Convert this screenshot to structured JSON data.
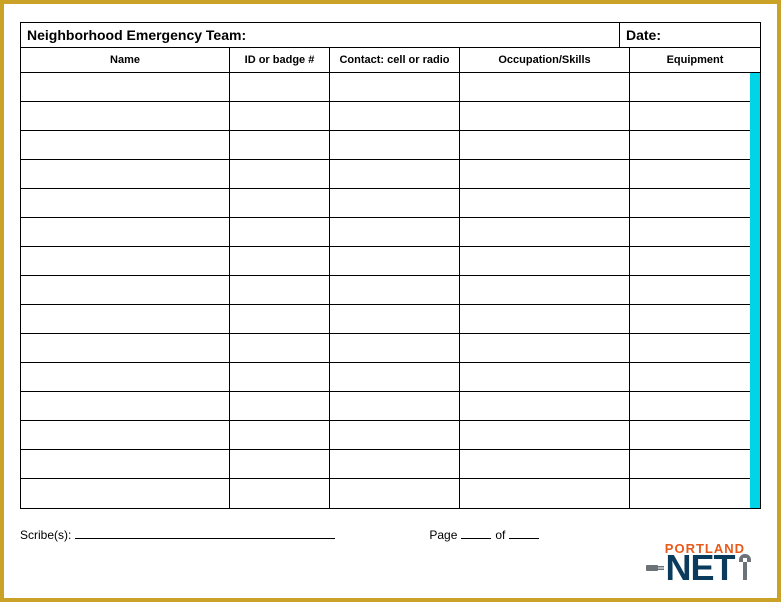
{
  "header": {
    "teamLabel": "Neighborhood Emergency Team:",
    "dateLabel": "Date:"
  },
  "columns": {
    "name": "Name",
    "idBadge": "ID or badge #",
    "contact": "Contact: cell or radio",
    "occupation": "Occupation/Skills",
    "equipment": "Equipment"
  },
  "rowCount": 15,
  "footer": {
    "scribeLabel": "Scribe(s):",
    "pageLabel": "Page",
    "ofLabel": "of"
  },
  "logo": {
    "topText": "PORTLAND",
    "mainText": "NET"
  }
}
